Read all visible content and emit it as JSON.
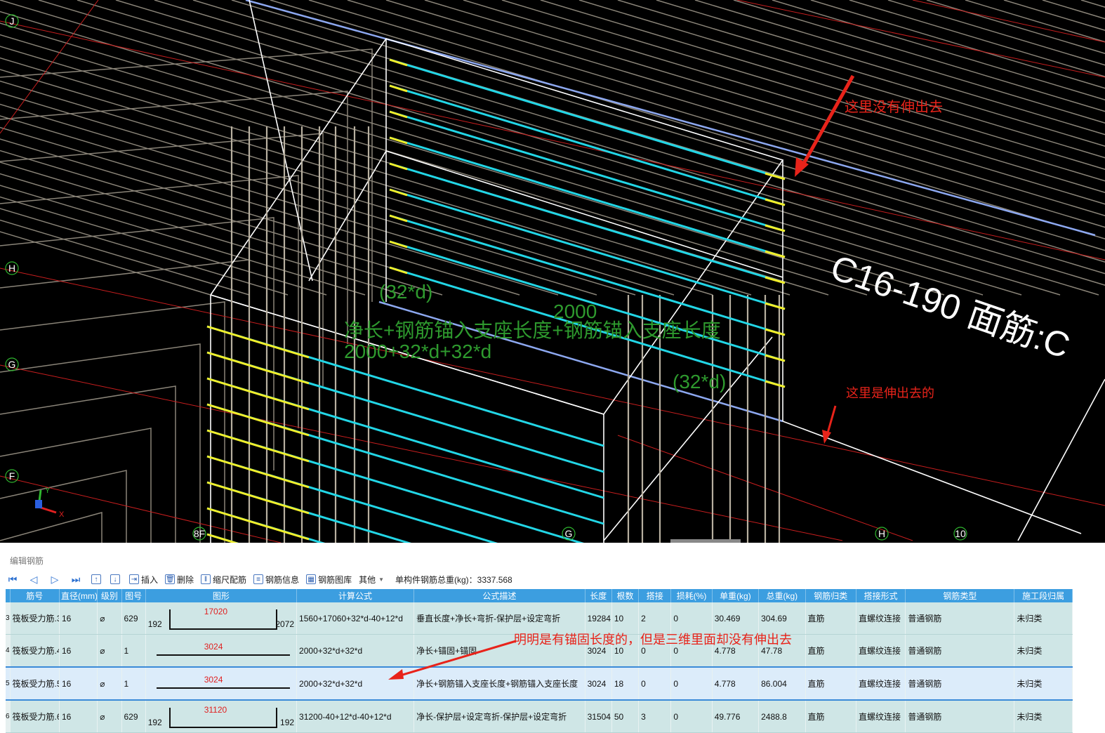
{
  "viewport": {
    "axis_labels": [
      {
        "text": "J",
        "name": "axis-label-j"
      },
      {
        "text": "H",
        "name": "axis-label-h-left"
      },
      {
        "text": "G",
        "name": "axis-label-g-left"
      },
      {
        "text": "F",
        "name": "axis-label-f"
      },
      {
        "text": "8F",
        "name": "axis-label-8f"
      },
      {
        "text": "G",
        "name": "axis-label-g-bottom"
      },
      {
        "text": "H",
        "name": "axis-label-h-bottom"
      },
      {
        "text": "10",
        "name": "axis-label-10"
      }
    ],
    "dim_left": "(32*d)",
    "dim_right": "(32*d)",
    "dim_length": "2000",
    "formula_desc": "净长+钢筋锚入支座长度+钢筋锚入支座长度",
    "formula_calc": "2000+32*d+32*d",
    "rebar_label": "C16-190 面筋:C",
    "coord_x": "X",
    "coord_y": "Y"
  },
  "annotations": {
    "top_right": "这里没有伸出去",
    "middle_right": "这里是伸出去的",
    "table_note": "明明是有锚固长度的，但是三维里面却没有伸出去"
  },
  "panel": {
    "title": "编辑钢筋",
    "toolbar": {
      "insert": "插入",
      "delete": "删除",
      "scale_rebar": "缩尺配筋",
      "rebar_info": "钢筋信息",
      "rebar_library": "钢筋图库",
      "other": "其他",
      "total_label": "单构件钢筋总重(kg)：3337.568"
    },
    "columns": [
      "筋号",
      "直径(mm)",
      "级别",
      "图号",
      "图形",
      "计算公式",
      "公式描述",
      "长度",
      "根数",
      "搭接",
      "损耗(%)",
      "单重(kg)",
      "总重(kg)",
      "钢筋归类",
      "搭接形式",
      "钢筋类型",
      "施工段归属"
    ],
    "rows": [
      {
        "num": "3",
        "name": "筏板受力筋.3",
        "dia": "16",
        "grade": "⌀",
        "fig": "629",
        "shape_left": "192",
        "shape_mid": "17020",
        "shape_right": "2072",
        "formula": "1560+17060+32*d-40+12*d",
        "desc": "垂直长度+净长+弯折-保护层+设定弯折",
        "len": "19284",
        "count": "10",
        "lap": "2",
        "loss": "0",
        "unit_w": "30.469",
        "total_w": "304.69",
        "category": "直筋",
        "lap_type": "直螺纹连接",
        "type": "普通钢筋",
        "stage": "未归类"
      },
      {
        "num": "4",
        "name": "筏板受力筋.4",
        "dia": "16",
        "grade": "⌀",
        "fig": "1",
        "shape_left": "",
        "shape_mid": "3024",
        "shape_right": "",
        "formula": "2000+32*d+32*d",
        "desc": "净长+锚固+锚固",
        "len": "3024",
        "count": "10",
        "lap": "0",
        "loss": "0",
        "unit_w": "4.778",
        "total_w": "47.78",
        "category": "直筋",
        "lap_type": "直螺纹连接",
        "type": "普通钢筋",
        "stage": "未归类"
      },
      {
        "num": "5",
        "name": "筏板受力筋.5",
        "dia": "16",
        "grade": "⌀",
        "fig": "1",
        "shape_left": "",
        "shape_mid": "3024",
        "shape_right": "",
        "formula": "2000+32*d+32*d",
        "desc": "净长+钢筋锚入支座长度+钢筋锚入支座长度",
        "len": "3024",
        "count": "18",
        "lap": "0",
        "loss": "0",
        "unit_w": "4.778",
        "total_w": "86.004",
        "category": "直筋",
        "lap_type": "直螺纹连接",
        "type": "普通钢筋",
        "stage": "未归类"
      },
      {
        "num": "6",
        "name": "筏板受力筋.6",
        "dia": "16",
        "grade": "⌀",
        "fig": "629",
        "shape_left": "192",
        "shape_mid": "31120",
        "shape_right": "192",
        "formula": "31200-40+12*d-40+12*d",
        "desc": "净长-保护层+设定弯折-保护层+设定弯折",
        "len": "31504",
        "count": "50",
        "lap": "3",
        "loss": "0",
        "unit_w": "49.776",
        "total_w": "2488.8",
        "category": "直筋",
        "lap_type": "直螺纹连接",
        "type": "普通钢筋",
        "stage": "未归类"
      }
    ],
    "selected_row_index": 2
  },
  "colors": {
    "viewport_bg": "#000000",
    "header_bg": "#3c9ee0",
    "row_bg": "#cfe6e6",
    "selected_row_bg": "#dcecfa",
    "annotation": "#e8231a",
    "dim_text": "#2e9a2e",
    "rebar_cyan": "#22d6e6",
    "rebar_yellow": "#f2ee2a"
  }
}
